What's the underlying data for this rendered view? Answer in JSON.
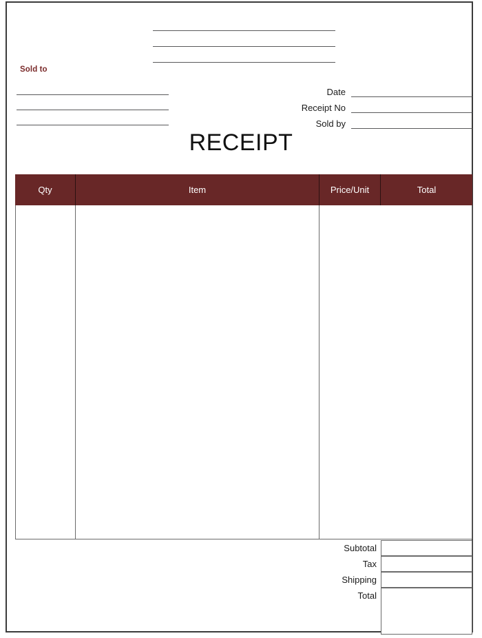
{
  "document": {
    "type": "receipt-template",
    "title": "RECEIPT"
  },
  "header": {
    "company_lines": [
      "",
      "",
      ""
    ],
    "sold_to_label": "Sold to",
    "sold_to_lines": [
      "",
      "",
      ""
    ]
  },
  "meta": {
    "rows": [
      {
        "label": "Date",
        "value": ""
      },
      {
        "label": "Receipt No",
        "value": ""
      },
      {
        "label": "Sold by",
        "value": ""
      }
    ]
  },
  "items_table": {
    "columns": [
      {
        "key": "qty",
        "header": "Qty"
      },
      {
        "key": "item",
        "header": "Item"
      },
      {
        "key": "price_unit",
        "header": "Price/Unit"
      },
      {
        "key": "total",
        "header": "Total"
      }
    ],
    "rows": []
  },
  "totals": {
    "rows": [
      {
        "label": "Subtotal",
        "value": ""
      },
      {
        "label": "Tax",
        "value": ""
      },
      {
        "label": "Shipping",
        "value": ""
      },
      {
        "label": "Total",
        "value": ""
      }
    ]
  },
  "colors": {
    "header_fill": "#682727",
    "header_text": "#ffffff",
    "accent_text": "#7a2a2a",
    "rule": "#58585a",
    "table_border": "#6a6a6a",
    "page_border": "#3a3a3a",
    "page_background": "#ffffff"
  }
}
